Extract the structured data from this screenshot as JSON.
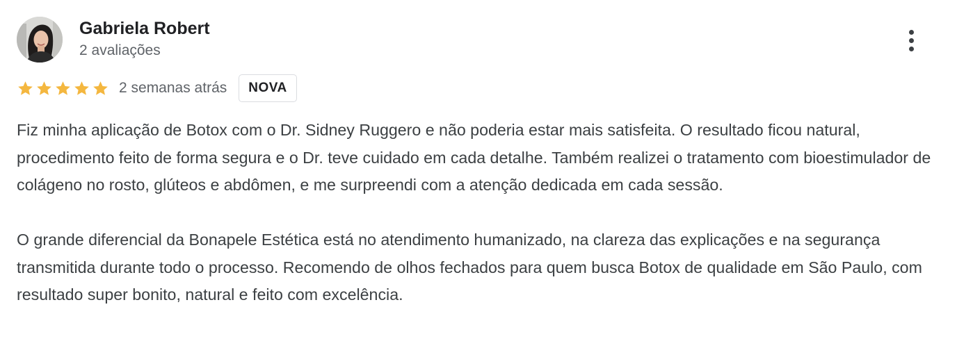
{
  "reviewer": {
    "name": "Gabriela Robert",
    "review_count": "2 avaliações"
  },
  "review": {
    "rating": 5,
    "max_rating": 5,
    "date": "2 semanas atrás",
    "badge": "NOVA",
    "paragraphs": [
      "Fiz minha aplicação de Botox com o Dr. Sidney Ruggero e não poderia estar mais satisfeita. O resultado ficou natural, procedimento feito de forma segura e o Dr. teve cuidado em cada detalhe. Também realizei o tratamento com bioestimulador de colágeno no rosto, glúteos e abdômen, e me surpreendi com a atenção dedicada em cada sessão.",
      "O grande diferencial da Bonapele Estética está no atendimento humanizado, na clareza das explicações e na segurança transmitida durante todo o processo. Recomendo de olhos fechados para quem busca Botox de qualidade em São Paulo, com resultado super bonito, natural e feito com excelência."
    ]
  },
  "icons": {
    "star": "star-icon",
    "more": "more-vert-icon",
    "avatar": "user-photo"
  },
  "colors": {
    "star": "#F4B73F",
    "name": "#202124",
    "meta": "#5F6368",
    "body_text": "#3C4043",
    "badge_border": "#DADCE0"
  }
}
